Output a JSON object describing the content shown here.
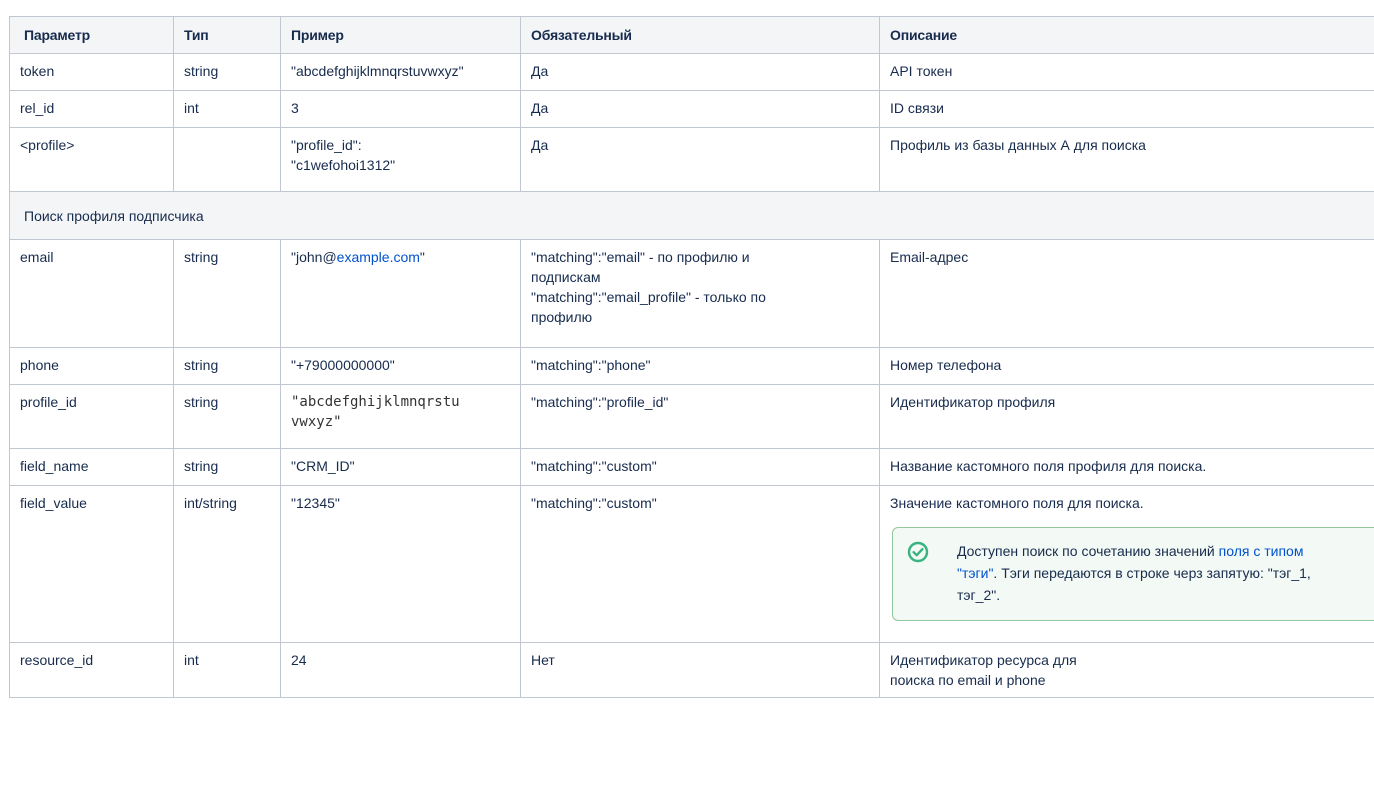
{
  "table": {
    "headers": [
      "Параметр",
      "Тип",
      "Пример",
      "Обязательный",
      "Описание"
    ],
    "rows_top": [
      {
        "param": "token",
        "type": "string",
        "example": "\"abcdefghijklmnqrstuvwxyz\"",
        "required": "Да",
        "description": "API токен"
      },
      {
        "param": "rel_id",
        "type": "int",
        "example": "3",
        "required": "Да",
        "description": "ID связи"
      },
      {
        "param": "<profile>",
        "type": "",
        "example_line1": "\"profile_id\":",
        "example_line2": "\"c1wefohoi1312\"",
        "required": "Да",
        "description": "Профиль из базы данных А для поиска"
      }
    ],
    "section_title": "Поиск профиля подписчика",
    "email_row": {
      "param": "email",
      "type": "string",
      "example_prefix": "\"john@",
      "example_link": "example.com",
      "example_suffix": "\"",
      "required_line1": "\"matching\":\"email\" - по профилю и",
      "required_line2": "подпискам",
      "required_line3": "\"matching\":\"email_profile\" - только по",
      "required_line4": "профилю",
      "description": "Email-адрес"
    },
    "phone_row": {
      "param": "phone",
      "type": "string",
      "example": "\"+79000000000\"",
      "required": "\"matching\":\"phone\"",
      "description": "Номер телефона"
    },
    "profile_id_row": {
      "param": "profile_id",
      "type": "string",
      "example_line1": "\"abcdefghijklmnqrstu",
      "example_line2": "vwxyz\"",
      "required": "\"matching\":\"profile_id\"",
      "description": "Идентификатор профиля"
    },
    "field_name_row": {
      "param": "field_name",
      "type": "string",
      "example": "\"CRM_ID\"",
      "required": "\"matching\":\"custom\"",
      "description": "Название кастомного поля профиля для поиска."
    },
    "field_value_row": {
      "param": "field_value",
      "type": "int/string",
      "example": "\"12345\"",
      "required": "\"matching\":\"custom\"",
      "description": "Значение кастомного поля для поиска.",
      "tip": {
        "icon": "check-circle-icon",
        "text_before": "Доступен поиск по сочетанию значений ",
        "link": "поля с типом \"тэги\"",
        "text_after": ". Тэги передаются в строке черз запятую: \"тэг_1, тэг_2\"."
      }
    },
    "resource_row": {
      "param": "resource_id",
      "type": "int",
      "example": "24",
      "required": "Нет",
      "description_line1": "Идентификатор ресурса для",
      "description_line2": "поиска по email и phone"
    }
  },
  "colors": {
    "header_bg": "#f4f5f7",
    "border": "#c1c7d0",
    "link": "#0052cc",
    "tip_bg": "#f3f9f4",
    "tip_border": "#91c89c",
    "tip_icon": "#36b37e"
  }
}
